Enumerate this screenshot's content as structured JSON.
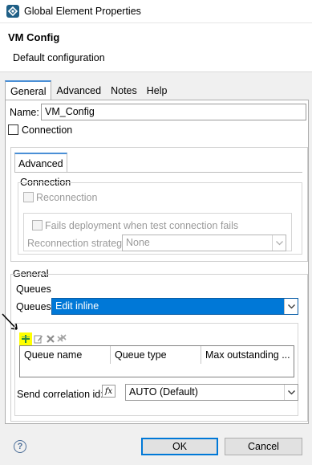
{
  "window": {
    "title": "Global Element Properties"
  },
  "header": {
    "title": "VM Config",
    "subtitle": "Default configuration"
  },
  "tabs": [
    {
      "label": "General",
      "active": true
    },
    {
      "label": "Advanced"
    },
    {
      "label": "Notes"
    },
    {
      "label": "Help"
    }
  ],
  "general": {
    "name_label": "Name:",
    "name_value": "VM_Config",
    "connection_label": "Connection",
    "connection_checked": false
  },
  "connection_box": {
    "tab_label": "Advanced",
    "section_label": "Connection",
    "reconnection_label": "Reconnection",
    "fails_deployment_label": "Fails deployment when test connection fails",
    "strategy_label": "Reconnection strategy",
    "strategy_value": "None"
  },
  "general_section": {
    "title": "General",
    "queues_title": "Queues",
    "queues_label": "Queues",
    "queues_value": "Edit inline",
    "table_columns": [
      "Queue name",
      "Queue type",
      "Max outstanding ..."
    ],
    "toolbar_icons": [
      "add-icon",
      "edit-icon",
      "delete-icon",
      "clear-icon"
    ],
    "send_correlation_label": "Send correlation id:",
    "send_correlation_value": "AUTO (Default)"
  },
  "footer": {
    "ok_label": "OK",
    "cancel_label": "Cancel"
  },
  "colors": {
    "accent": "#0078d7",
    "tab_highlight": "#4a8fd6",
    "annotation_highlight": "#ffff00"
  }
}
